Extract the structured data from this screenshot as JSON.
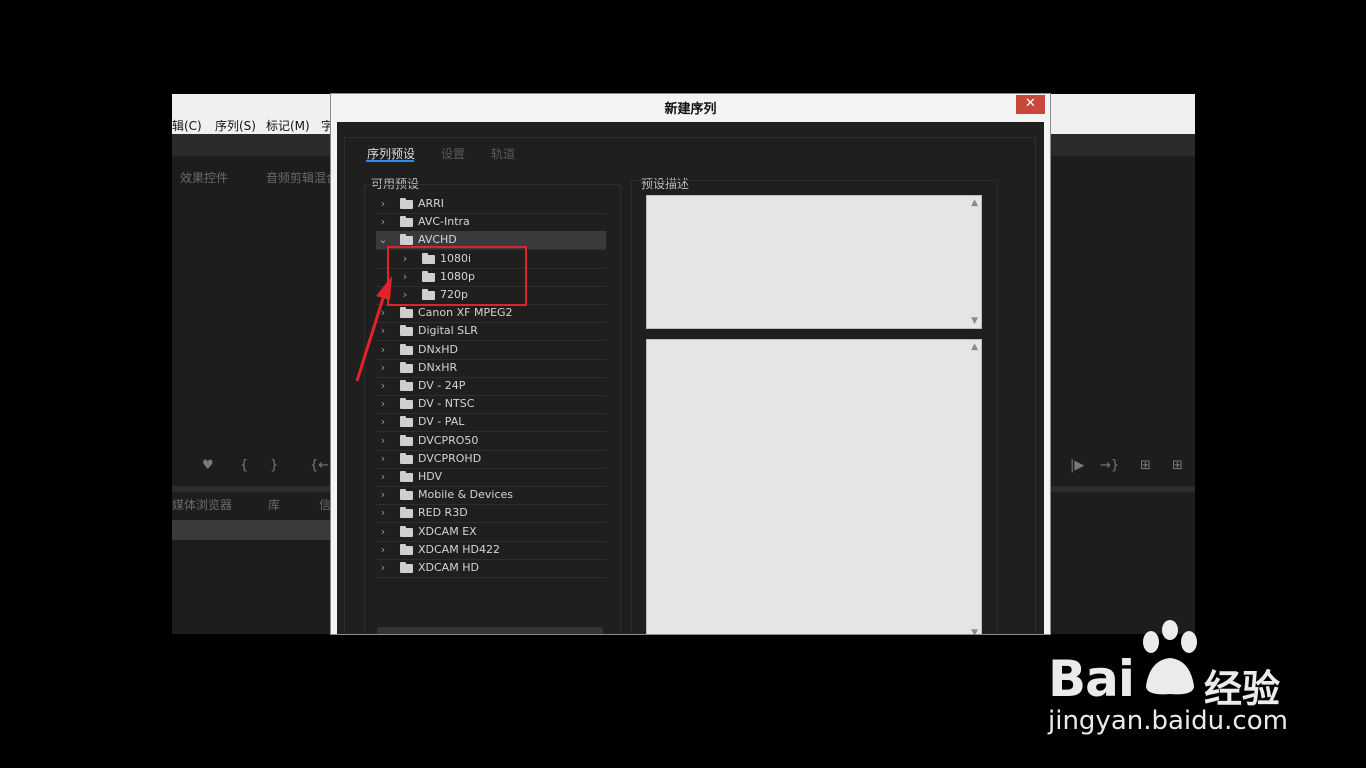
{
  "app": {
    "menu": [
      "辑(C)",
      "序列(S)",
      "标记(M)",
      "字"
    ],
    "panel_tabs_top": [
      "效果控件",
      "音频剪辑混合"
    ],
    "panel_tabs_bottom": [
      "媒体浏览器",
      "库",
      "信"
    ]
  },
  "dialog": {
    "title": "新建序列",
    "close_label": "✕",
    "tabs": [
      "序列预设",
      "设置",
      "轨道"
    ],
    "available_presets_label": "可用预设",
    "preset_description_label": "预设描述",
    "presets": [
      {
        "label": "ARRI",
        "level": 0,
        "expanded": false
      },
      {
        "label": "AVC-Intra",
        "level": 0,
        "expanded": false
      },
      {
        "label": "AVCHD",
        "level": 0,
        "expanded": true,
        "selected": true
      },
      {
        "label": "1080i",
        "level": 1,
        "expanded": false
      },
      {
        "label": "1080p",
        "level": 1,
        "expanded": false
      },
      {
        "label": "720p",
        "level": 1,
        "expanded": false
      },
      {
        "label": "Canon XF MPEG2",
        "level": 0,
        "expanded": false
      },
      {
        "label": "Digital SLR",
        "level": 0,
        "expanded": false
      },
      {
        "label": "DNxHD",
        "level": 0,
        "expanded": false
      },
      {
        "label": "DNxHR",
        "level": 0,
        "expanded": false
      },
      {
        "label": "DV - 24P",
        "level": 0,
        "expanded": false
      },
      {
        "label": "DV - NTSC",
        "level": 0,
        "expanded": false
      },
      {
        "label": "DV - PAL",
        "level": 0,
        "expanded": false
      },
      {
        "label": "DVCPRO50",
        "level": 0,
        "expanded": false
      },
      {
        "label": "DVCPROHD",
        "level": 0,
        "expanded": false
      },
      {
        "label": "HDV",
        "level": 0,
        "expanded": false
      },
      {
        "label": "Mobile & Devices",
        "level": 0,
        "expanded": false
      },
      {
        "label": "RED R3D",
        "level": 0,
        "expanded": false
      },
      {
        "label": "XDCAM EX",
        "level": 0,
        "expanded": false
      },
      {
        "label": "XDCAM HD422",
        "level": 0,
        "expanded": false
      },
      {
        "label": "XDCAM HD",
        "level": 0,
        "expanded": false
      }
    ]
  },
  "colors": {
    "highlight": "#e0232b",
    "tab_underline": "#2d8ceb",
    "close_button": "#c9483c"
  },
  "watermark": {
    "brand": "Bai",
    "brand_suffix": "经验",
    "url": "jingyan.baidu.com"
  }
}
